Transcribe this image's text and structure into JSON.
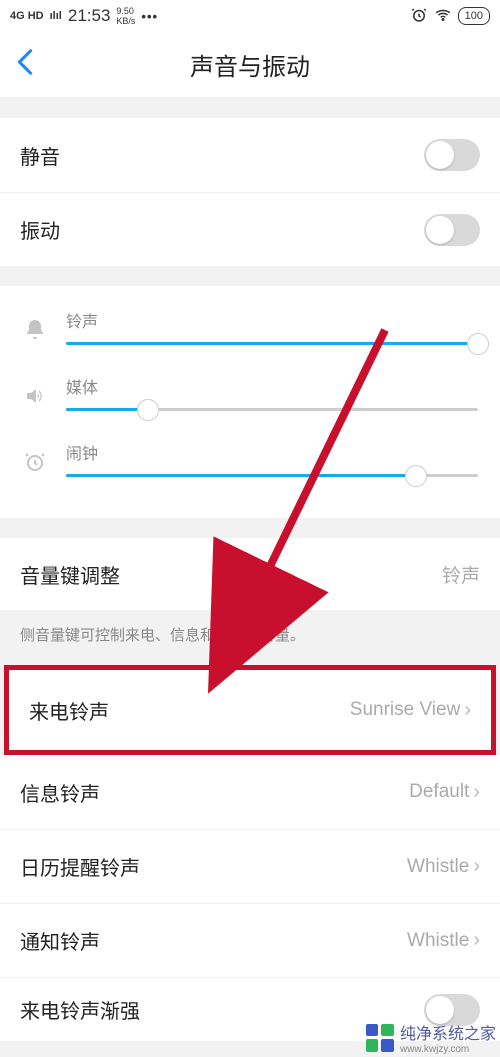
{
  "status": {
    "network_type": "4G HD",
    "signal_bars": "ılıl",
    "time": "21:53",
    "speed_top": "9.50",
    "speed_bottom": "KB/s",
    "more": "•••",
    "battery": "100"
  },
  "nav": {
    "title": "声音与振动"
  },
  "toggles": {
    "mute_label": "静音",
    "vibrate_label": "振动"
  },
  "sliders": {
    "ringtone": {
      "label": "铃声",
      "percent": 100
    },
    "media": {
      "label": "媒体",
      "percent": 20
    },
    "alarm": {
      "label": "闹钟",
      "percent": 85
    }
  },
  "volume_key": {
    "label": "音量键调整",
    "value": "铃声",
    "hint": "侧音量键可控制来电、信息和通知的音量。"
  },
  "ringtones": {
    "incoming": {
      "label": "来电铃声",
      "value": "Sunrise View"
    },
    "message": {
      "label": "信息铃声",
      "value": "Default"
    },
    "calendar": {
      "label": "日历提醒铃声",
      "value": "Whistle"
    },
    "notify": {
      "label": "通知铃声",
      "value": "Whistle"
    },
    "crescendo": {
      "label": "来电铃声渐强"
    }
  },
  "watermark": {
    "text": "纯净系统之家",
    "url": "www.kwjzy.com"
  }
}
